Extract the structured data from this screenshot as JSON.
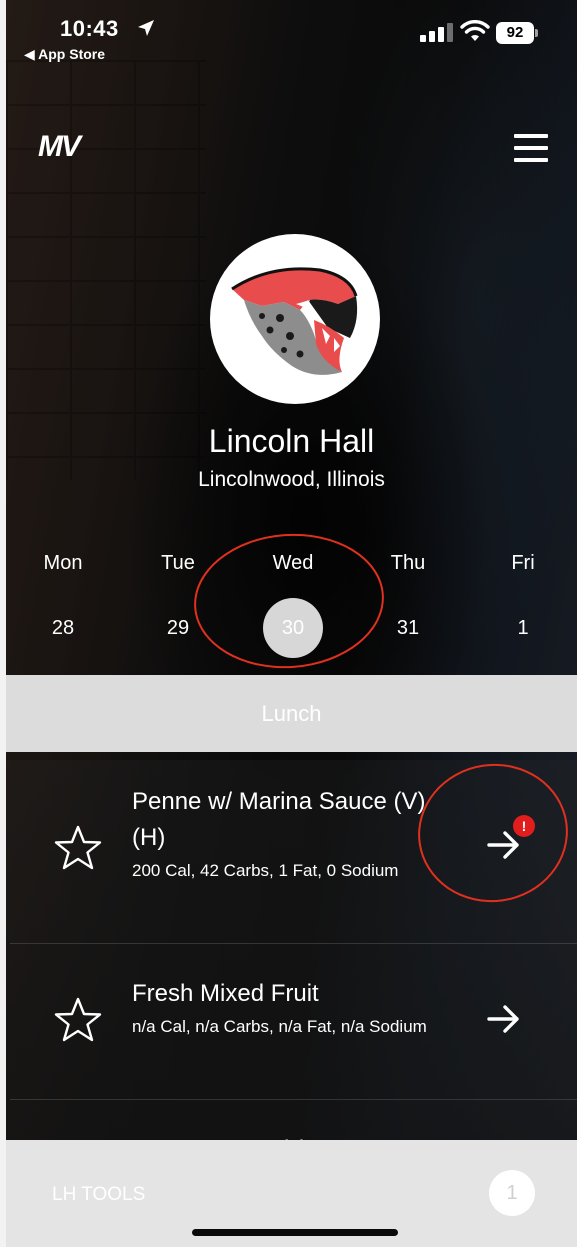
{
  "status_bar": {
    "time": "10:43",
    "back_app": "◀ App Store",
    "battery": "92"
  },
  "header": {
    "logo": "MV",
    "menu_icon": "hamburger-menu-icon"
  },
  "school": {
    "name": "Lincoln Hall",
    "location": "Lincolnwood, Illinois",
    "logo_icon": "jaguar-mascot-logo"
  },
  "week": {
    "days": [
      {
        "name": "Mon",
        "date": "28"
      },
      {
        "name": "Tue",
        "date": "29"
      },
      {
        "name": "Wed",
        "date": "30"
      },
      {
        "name": "Thu",
        "date": "31"
      },
      {
        "name": "Fri",
        "date": "1"
      }
    ],
    "selected_index": 2
  },
  "meal": {
    "label": "Lunch"
  },
  "menu_items": [
    {
      "title": "Penne w/ Marina Sauce (V)(H)",
      "nutrition": "200 Cal, 42 Carbs, 1 Fat, 0 Sodium",
      "alert_badge": "!"
    },
    {
      "title": "Fresh Mixed Fruit",
      "nutrition": "n/a Cal, n/a Carbs, n/a Fat, n/a Sodium"
    },
    {
      "title": "Tomato Soup (v)",
      "nutrition": ""
    }
  ],
  "footer": {
    "tools_label": "LH TOOLS",
    "count": "1"
  },
  "colors": {
    "annotation": "#e0301e",
    "badge": "#e11d1d",
    "selected_day": "#d7d7d7"
  }
}
